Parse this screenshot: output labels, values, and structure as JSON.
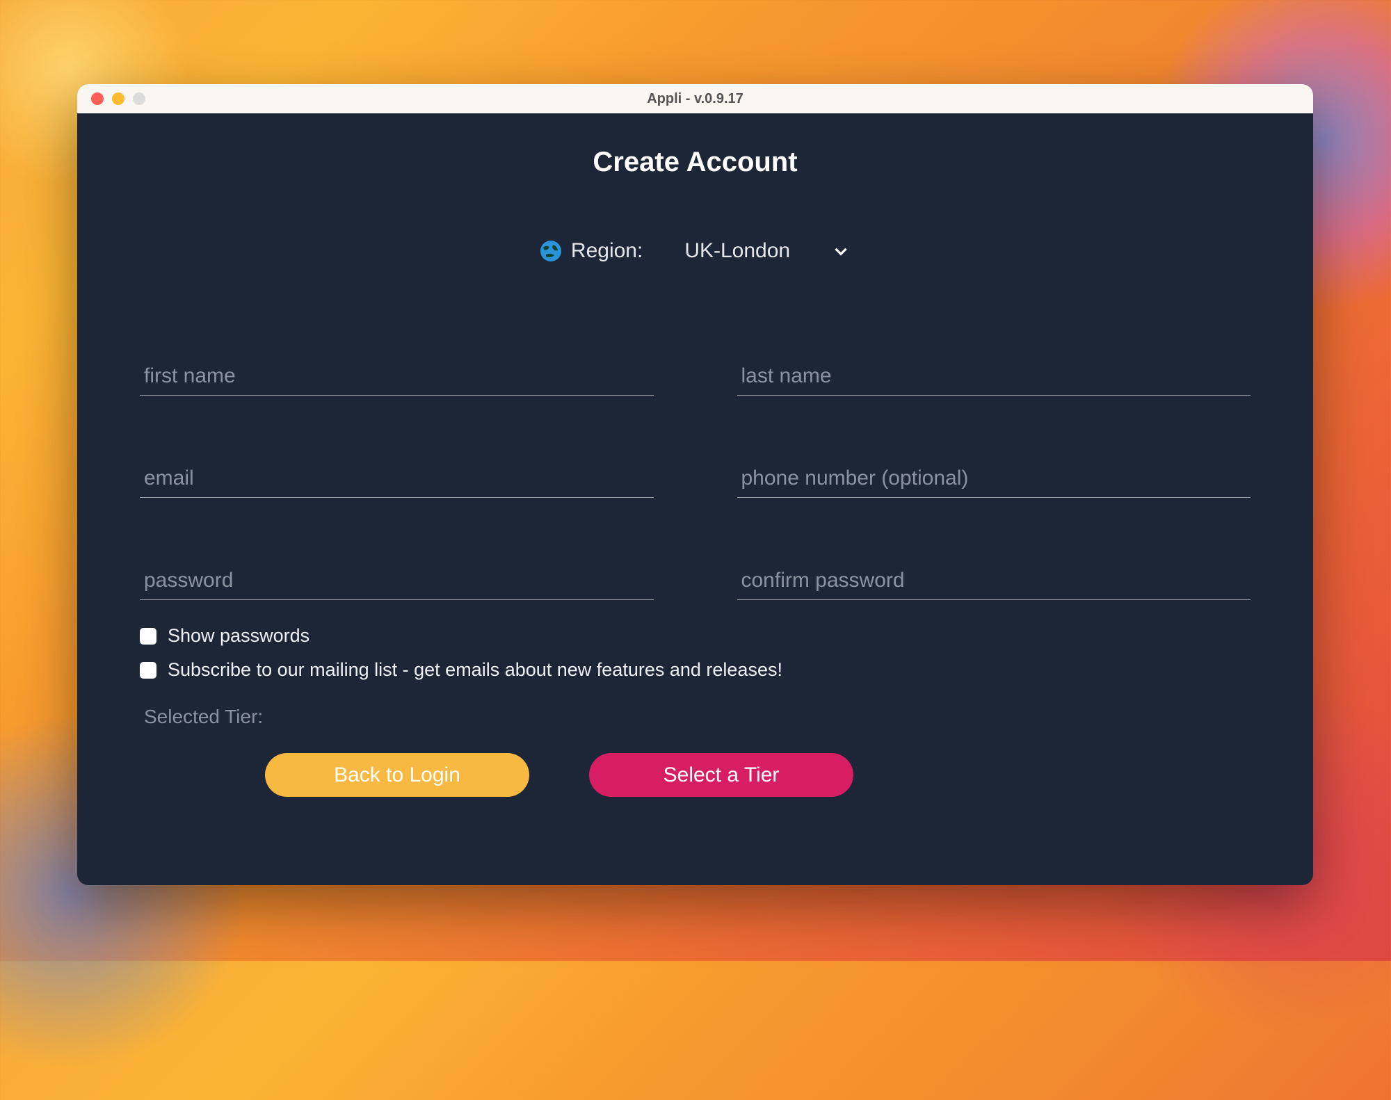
{
  "window": {
    "title": "Appli - v.0.9.17"
  },
  "page": {
    "title": "Create Account"
  },
  "region": {
    "label": "Region:",
    "selected": "UK-London"
  },
  "fields": {
    "first_name": {
      "value": "",
      "placeholder": "first name"
    },
    "last_name": {
      "value": "",
      "placeholder": "last name"
    },
    "email": {
      "value": "",
      "placeholder": "email"
    },
    "phone": {
      "value": "",
      "placeholder": "phone number (optional)"
    },
    "password": {
      "value": "",
      "placeholder": "password"
    },
    "confirm_password": {
      "value": "",
      "placeholder": "confirm password"
    }
  },
  "checks": {
    "show_passwords": {
      "checked": false,
      "label": "Show passwords"
    },
    "subscribe": {
      "checked": false,
      "label": "Subscribe to our mailing list - get emails about new features and releases!"
    }
  },
  "tier": {
    "label": "Selected Tier:",
    "value": ""
  },
  "buttons": {
    "back": "Back to Login",
    "select_tier": "Select a Tier"
  }
}
